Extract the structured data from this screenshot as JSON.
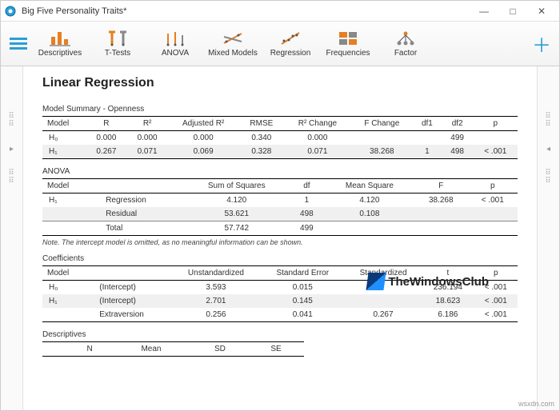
{
  "window": {
    "title": "Big Five Personality Traits*",
    "min": "—",
    "max": "□",
    "close": "✕"
  },
  "toolbar": {
    "items": [
      {
        "label": "Descriptives"
      },
      {
        "label": "T-Tests"
      },
      {
        "label": "ANOVA"
      },
      {
        "label": "Mixed Models"
      },
      {
        "label": "Regression"
      },
      {
        "label": "Frequencies"
      },
      {
        "label": "Factor"
      }
    ]
  },
  "page": {
    "title": "Linear Regression",
    "summary_title": "Model Summary - Openness",
    "summary_headers": [
      "Model",
      "R",
      "R²",
      "Adjusted R²",
      "RMSE",
      "R² Change",
      "F Change",
      "df1",
      "df2",
      "p"
    ],
    "summary_rows": [
      {
        "model": "H₀",
        "R": "0.000",
        "R2": "0.000",
        "adjR2": "0.000",
        "RMSE": "0.340",
        "R2ch": "0.000",
        "Fch": "",
        "df1": "",
        "df2": "499",
        "p": ""
      },
      {
        "model": "H₁",
        "R": "0.267",
        "R2": "0.071",
        "adjR2": "0.069",
        "RMSE": "0.328",
        "R2ch": "0.071",
        "Fch": "38.268",
        "df1": "1",
        "df2": "498",
        "p": "< .001"
      }
    ],
    "anova_title": "ANOVA",
    "anova_headers": [
      "Model",
      "",
      "Sum of Squares",
      "df",
      "Mean Square",
      "F",
      "p"
    ],
    "anova_model": "H₁",
    "anova_rows": [
      {
        "src": "Regression",
        "ss": "4.120",
        "df": "1",
        "ms": "4.120",
        "F": "38.268",
        "p": "< .001"
      },
      {
        "src": "Residual",
        "ss": "53.621",
        "df": "498",
        "ms": "0.108",
        "F": "",
        "p": ""
      },
      {
        "src": "Total",
        "ss": "57.742",
        "df": "499",
        "ms": "",
        "F": "",
        "p": ""
      }
    ],
    "anova_note": "Note. The intercept model is omitted, as no meaningful information can be shown.",
    "coef_title": "Coefficients",
    "coef_headers": [
      "Model",
      "",
      "Unstandardized",
      "Standard Error",
      "Standardized",
      "t",
      "p"
    ],
    "coef_rows": [
      {
        "model": "H₀",
        "term": "(Intercept)",
        "un": "3.593",
        "se": "0.015",
        "std": "",
        "t": "236.194",
        "p": "< .001"
      },
      {
        "model": "H₁",
        "term": "(Intercept)",
        "un": "2.701",
        "se": "0.145",
        "std": "",
        "t": "18.623",
        "p": "< .001"
      },
      {
        "model": "",
        "term": "Extraversion",
        "un": "0.256",
        "se": "0.041",
        "std": "0.267",
        "t": "6.186",
        "p": "< .001"
      }
    ],
    "desc_title": "Descriptives",
    "desc_headers": [
      "",
      "N",
      "Mean",
      "SD",
      "SE"
    ]
  },
  "watermark": "TheWindowsClub",
  "footer_wm": "wsxdn.com"
}
